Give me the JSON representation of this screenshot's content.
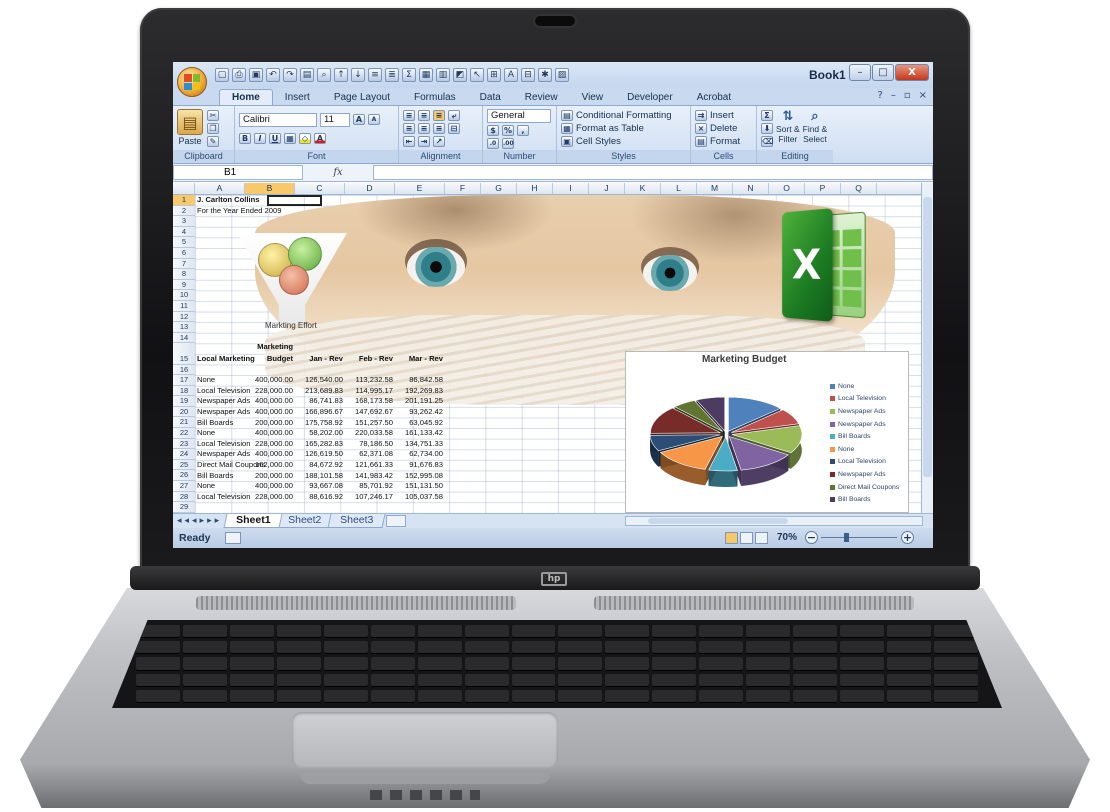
{
  "window": {
    "title": "Book1 ...",
    "controls": [
      "–",
      "□",
      "X"
    ]
  },
  "tabs": [
    "Home",
    "Insert",
    "Page Layout",
    "Formulas",
    "Data",
    "Review",
    "View",
    "Developer",
    "Acrobat"
  ],
  "active_tab": "Home",
  "ribbon": {
    "clipboard": {
      "label": "Clipboard",
      "paste": "Paste"
    },
    "font": {
      "label": "Font",
      "name": "Calibri",
      "size": "11",
      "bold": "B",
      "italic": "I",
      "underline": "U",
      "grow": "A",
      "shrink": "A"
    },
    "alignment": {
      "label": "Alignment"
    },
    "number": {
      "label": "Number",
      "format": "General",
      "currency": "$",
      "percent": "%",
      "comma": ",",
      "inc": ".0",
      "dec": ".00"
    },
    "styles": {
      "label": "Styles",
      "conditional": "Conditional Formatting",
      "table": "Format as Table",
      "cell": "Cell Styles"
    },
    "cells": {
      "label": "Cells",
      "insert": "Insert",
      "delete": "Delete",
      "format": "Format"
    },
    "editing": {
      "label": "Editing",
      "sort": "Sort &",
      "filter": "Filter",
      "find": "Find &",
      "select": "Select",
      "sum": "Σ"
    }
  },
  "formula_bar": {
    "name_box": "B1",
    "fx": "fx",
    "value": ""
  },
  "columns": [
    "A",
    "B",
    "C",
    "D",
    "E",
    "F",
    "G",
    "H",
    "I",
    "J",
    "K",
    "L",
    "M",
    "N",
    "O",
    "P",
    "Q"
  ],
  "selected_column": "B",
  "rows": [
    "1",
    "2",
    "3",
    "4",
    "5",
    "6",
    "7",
    "8",
    "9",
    "10",
    "11",
    "12",
    "13",
    "14",
    "15",
    "16",
    "17",
    "18",
    "19",
    "20",
    "21",
    "22",
    "23",
    "24",
    "25",
    "26",
    "27",
    "28",
    "29"
  ],
  "sheet": {
    "title": "J. Carlton Collins",
    "subtitle": "For the Year Ended 2009",
    "header_top": "Marketing",
    "headers": [
      "Local Marketing",
      "Budget",
      "Jan - Rev",
      "Feb - Rev",
      "Mar - Rev"
    ],
    "data": [
      [
        "None",
        "400,000.00",
        "126,540.00",
        "113,232.58",
        "86,842.58"
      ],
      [
        "Local Television",
        "228,000.00",
        "213,689.83",
        "114,995.17",
        "192,269.83"
      ],
      [
        "Newspaper Ads",
        "400,000.00",
        "86,741.83",
        "168,173.58",
        "201,191.25"
      ],
      [
        "Newspaper Ads",
        "400,000.00",
        "166,896.67",
        "147,692.67",
        "93,262.42"
      ],
      [
        "Bill Boards",
        "200,000.00",
        "175,758.92",
        "151,257.50",
        "63,045.92"
      ],
      [
        "None",
        "400,000.00",
        "58,202.00",
        "220,033.58",
        "161,133.42"
      ],
      [
        "Local Television",
        "228,000.00",
        "165,282.83",
        "78,186.50",
        "134,751.33"
      ],
      [
        "Newspaper Ads",
        "400,000.00",
        "126,619.50",
        "62,371.08",
        "62,734.00"
      ],
      [
        "Direct Mail Coupons",
        "162,000.00",
        "84,672.92",
        "121,661.33",
        "91,676.83"
      ],
      [
        "Bill Boards",
        "200,000.00",
        "188,101.58",
        "141,983.42",
        "152,995.08"
      ],
      [
        "None",
        "400,000.00",
        "93,667.08",
        "85,701.92",
        "151,131.50"
      ],
      [
        "Local Television",
        "228,000.00",
        "88,616.92",
        "107,246.17",
        "105,037.58"
      ]
    ]
  },
  "graphic": {
    "funnel_label": "Markting Effort"
  },
  "chart_data": {
    "type": "pie",
    "title": "Marketing Budget",
    "categories": [
      "None",
      "Local Television",
      "Newspaper Ads",
      "Newspaper Ads",
      "Bill Boards",
      "None",
      "Local Television",
      "Newspaper Ads",
      "Direct Mail Coupons",
      "Bill Boards"
    ],
    "values": [
      400000,
      228000,
      400000,
      400000,
      200000,
      400000,
      228000,
      400000,
      162000,
      200000
    ],
    "colors": [
      "#4f81bd",
      "#c0504d",
      "#9bbb59",
      "#8064a2",
      "#4bacc6",
      "#f79646",
      "#2c4d75",
      "#772c2a",
      "#5f7530",
      "#4d3b62"
    ],
    "legend": "right",
    "exploded": true
  },
  "sheets": [
    "Sheet1",
    "Sheet2",
    "Sheet3"
  ],
  "active_sheet": "Sheet1",
  "status": {
    "text": "Ready",
    "zoom": "70%",
    "zoom_level": 0.7
  }
}
